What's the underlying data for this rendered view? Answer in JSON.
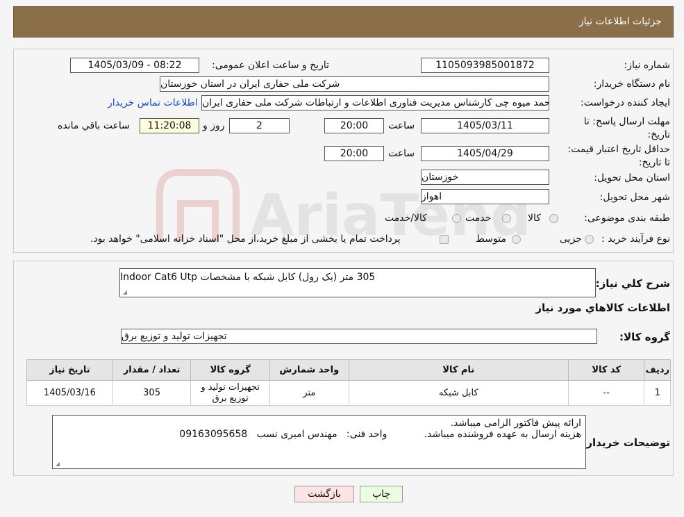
{
  "header": {
    "title": "جزئیات اطلاعات نیاز"
  },
  "info": {
    "need_number_label": "شماره نیاز:",
    "need_number": "1105093985001872",
    "announce_label": "تاریخ و ساعت اعلان عمومی:",
    "announce_value": "1405/03/09 - 08:22",
    "buyer_label": "نام دستگاه خریدار:",
    "buyer_value": "شرکت ملی حفاری ایران در استان خوزستان",
    "creator_label": "ایجاد کننده درخواست:",
    "creator_value": "محمد میوه چی کارشناس مدیریت فناوری اطلاعات و ارتباطات  شرکت ملی حفاری ایران",
    "contact_link": "اطلاعات تماس خریدار",
    "deadline_label": "مهلت ارسال پاسخ: تا تاریخ:",
    "deadline_date": "1405/03/11",
    "time_label": "ساعت",
    "deadline_time": "20:00",
    "days_value": "2",
    "days_label": "روز و",
    "remaining_time": "11:20:08",
    "remaining_label": "ساعت باقي مانده",
    "validity_label": "حداقل تاریخ اعتبار قیمت: تا تاریخ:",
    "validity_date": "1405/04/29",
    "validity_time": "20:00",
    "province_label": "استان محل تحویل:",
    "province_value": "خوزستان",
    "city_label": "شهر محل تحویل:",
    "city_value": "اهواز",
    "category_label": "طبقه بندی موضوعی:",
    "category_options": [
      "کالا",
      "خدمت",
      "کالا/خدمت"
    ],
    "process_label": "نوع فرآیند خرید :",
    "process_options": [
      "جزیی",
      "متوسط"
    ],
    "process_note": "پرداخت تمام یا بخشی از مبلغ خرید،از محل \"اسناد خزانه اسلامی\" خواهد بود."
  },
  "watermark": {
    "text": "AriaTender.neT"
  },
  "details": {
    "summary_label": "شرح کلي نياز:",
    "summary_value": "305 متر  (یک رول) کابل شبکه با مشخصات Indoor Cat6 Utp",
    "goods_info_title": "اطلاعات کالاهاي مورد نياز",
    "group_label": "گروه کالا:",
    "group_value": "تجهیزات تولید و توزیع برق",
    "table": {
      "headers": [
        "رديف",
        "کد کالا",
        "نام کالا",
        "واحد شمارش",
        "گروه کالا",
        "تعداد / مقدار",
        "تاریخ نیاز"
      ],
      "rows": [
        [
          "1",
          "--",
          "کابل شبکه",
          "متر",
          "تجهیزات تولید و توزیع برق",
          "305",
          "1405/03/16"
        ]
      ]
    },
    "buyer_notes_label": "توضیحات خریدار:",
    "buyer_notes_line1": "ارائه پیش فاکتور الزامی میباشد.",
    "buyer_notes_line2": "هزینه ارسال به عهده فروشنده میباشد.            واحد فنی:   مهندس امیری نسب   09163095658"
  },
  "buttons": {
    "print": "چاپ",
    "back": "بازگشت"
  },
  "colors": {
    "header": "#8b6f4a",
    "link": "#1a4fb8",
    "back_button": "#fde3e3",
    "print_button": "#eaffdf",
    "timer_bg": "#ffffe0"
  }
}
